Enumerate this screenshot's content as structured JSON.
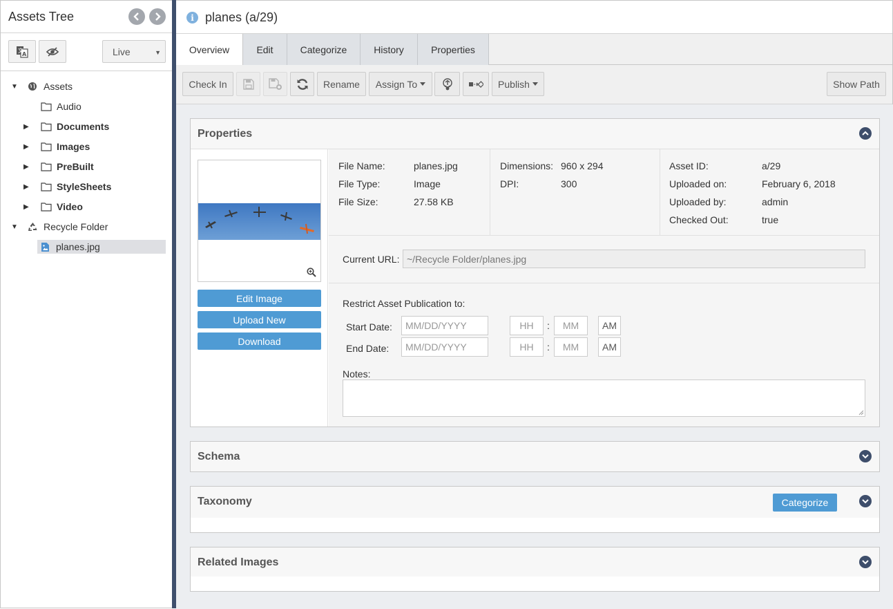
{
  "sidebar": {
    "title": "Assets Tree",
    "prev_icon": "chevron-left-icon",
    "next_icon": "chevron-right-icon",
    "view_select": "Live",
    "tree": [
      {
        "label": "Assets",
        "icon": "globe-icon",
        "expanded": true,
        "bold": false
      },
      {
        "label": "Audio",
        "icon": "folder-icon",
        "bold": false
      },
      {
        "label": "Documents",
        "icon": "folder-icon",
        "bold": true
      },
      {
        "label": "Images",
        "icon": "folder-icon",
        "bold": true
      },
      {
        "label": "PreBuilt",
        "icon": "folder-icon",
        "bold": true
      },
      {
        "label": "StyleSheets",
        "icon": "folder-icon",
        "bold": true
      },
      {
        "label": "Video",
        "icon": "folder-icon",
        "bold": true
      },
      {
        "label": "Recycle Folder",
        "icon": "recycle-icon",
        "expanded": true,
        "bold": false
      },
      {
        "label": "planes.jpg",
        "icon": "image-file-icon",
        "selected": true,
        "bold": false
      }
    ]
  },
  "header": {
    "title": "planes (a/29)"
  },
  "tabs": [
    "Overview",
    "Edit",
    "Categorize",
    "History",
    "Properties"
  ],
  "toolbar": {
    "check_in": "Check In",
    "rename": "Rename",
    "assign_to": "Assign To",
    "publish": "Publish",
    "show_path": "Show Path"
  },
  "properties": {
    "title": "Properties",
    "buttons": {
      "edit_image": "Edit Image",
      "upload_new": "Upload New",
      "download": "Download"
    },
    "file_name_label": "File Name:",
    "file_name": "planes.jpg",
    "file_type_label": "File Type:",
    "file_type": "Image",
    "file_size_label": "File Size:",
    "file_size": "27.58 KB",
    "dimensions_label": "Dimensions:",
    "dimensions": "960 x 294",
    "dpi_label": "DPI:",
    "dpi": "300",
    "asset_id_label": "Asset ID:",
    "asset_id": "a/29",
    "uploaded_on_label": "Uploaded on:",
    "uploaded_on": "February 6, 2018",
    "uploaded_by_label": "Uploaded by:",
    "uploaded_by": "admin",
    "checked_out_label": "Checked Out:",
    "checked_out": "true",
    "current_url_label": "Current URL:",
    "current_url": "~/Recycle Folder/planes.jpg",
    "restrict_label": "Restrict Asset Publication to:",
    "start_date_label": "Start Date:",
    "end_date_label": "End Date:",
    "date_placeholder": "MM/DD/YYYY",
    "hh_placeholder": "HH",
    "mm_placeholder": "MM",
    "ampm": "AM",
    "time_sep": ":",
    "notes_label": "Notes:"
  },
  "schema": {
    "title": "Schema"
  },
  "taxonomy": {
    "title": "Taxonomy",
    "categorize_button": "Categorize"
  },
  "related_images": {
    "title": "Related Images"
  },
  "colors": {
    "accent": "#4f9bd4",
    "splitter": "#3f4f6c",
    "chevron": "#3e4e6b"
  }
}
